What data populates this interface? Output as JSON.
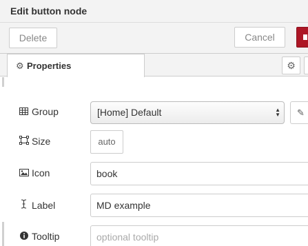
{
  "tray": {
    "title": "Edit button node"
  },
  "toolbar": {
    "delete_label": "Delete",
    "cancel_label": "Cancel",
    "done_color": "#ad1625"
  },
  "tabs": {
    "active_label": "Properties",
    "active_icon": "gear-icon",
    "settings_icon": "gear-icon"
  },
  "form": {
    "group": {
      "label": "Group",
      "icon": "table-icon",
      "value": "[Home] Default",
      "edit_icon": "pencil-icon"
    },
    "size": {
      "label": "Size",
      "icon": "resize-icon",
      "value": "auto"
    },
    "icon_field": {
      "label": "Icon",
      "icon": "picture-icon",
      "value": "book"
    },
    "label_field": {
      "label": "Label",
      "icon": "text-cursor-icon",
      "value": "MD example"
    },
    "tooltip": {
      "label": "Tooltip",
      "icon": "info-circle-icon",
      "placeholder": "optional tooltip"
    }
  }
}
